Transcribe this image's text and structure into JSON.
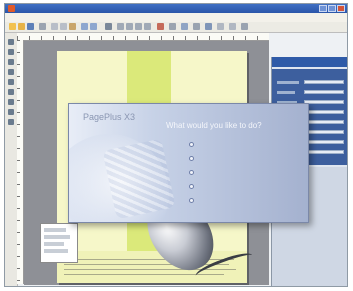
{
  "window": {
    "title": ""
  },
  "dialog": {
    "brand": "PagePlus",
    "brand_version": "X3",
    "brand_sub": "",
    "heading": "What would you like to do?",
    "options": [
      {
        "label": "",
        "icon": "sparkle-icon"
      },
      {
        "label": "",
        "icon": "design-icon"
      },
      {
        "label": "",
        "icon": "create-icon"
      },
      {
        "label": "",
        "icon": "open-icon"
      },
      {
        "label": "",
        "icon": "tutorial-icon"
      }
    ]
  },
  "colors": {
    "title_bar": "#2a55a8",
    "page": "#f6f7c9",
    "page_strip": "#dbe97a",
    "dialog_accent": "#a4b1cf",
    "side_panel": "#3d5f9e"
  }
}
